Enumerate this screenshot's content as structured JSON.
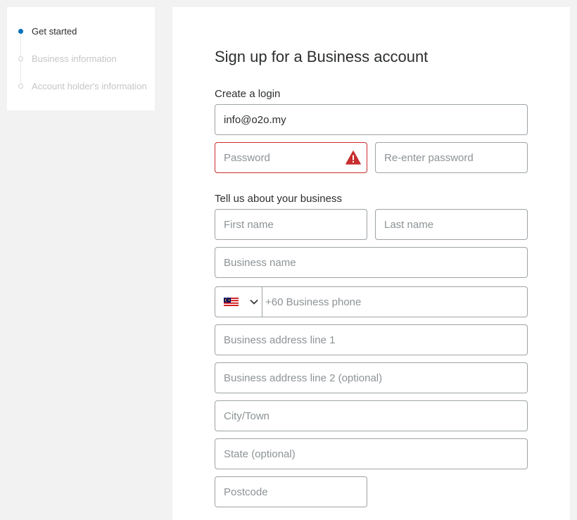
{
  "sidebar": {
    "steps": [
      {
        "label": "Get started",
        "active": true
      },
      {
        "label": "Business information",
        "active": false
      },
      {
        "label": "Account holder's information",
        "active": false
      }
    ]
  },
  "form": {
    "title": "Sign up for a Business account",
    "login_section": "Create a login",
    "email": {
      "value": "info@o2o.my"
    },
    "password": {
      "placeholder": "Password"
    },
    "reenter_password": {
      "placeholder": "Re-enter password"
    },
    "business_section": "Tell us about your business",
    "first_name": {
      "placeholder": "First name"
    },
    "last_name": {
      "placeholder": "Last name"
    },
    "business_name": {
      "placeholder": "Business name"
    },
    "phone": {
      "country_flag": "malaysia-flag-icon",
      "placeholder": "+60 Business phone"
    },
    "address_line1": {
      "placeholder": "Business address line 1"
    },
    "address_line2": {
      "placeholder": "Business address line 2 (optional)"
    },
    "city": {
      "placeholder": "City/Town"
    },
    "state": {
      "placeholder": "State (optional)"
    },
    "postcode": {
      "placeholder": "Postcode"
    }
  },
  "colors": {
    "active_step": "#0070ba",
    "error_border": "#c72e2e",
    "field_border": "#9da3a6",
    "background": "#f2f2f2"
  }
}
